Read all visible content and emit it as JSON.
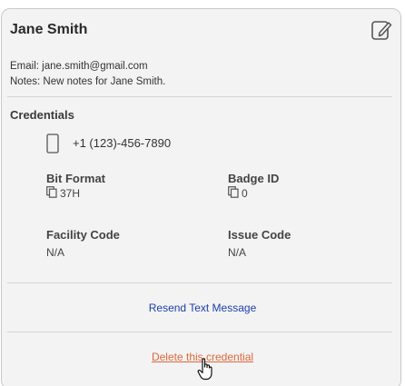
{
  "contact": {
    "name": "Jane Smith",
    "email": "Email: jane.smith@gmail.com",
    "notes": "Notes: New notes for Jane Smith."
  },
  "credentials": {
    "title": "Credentials",
    "phone": "+1 (123)-456-7890",
    "bit_format_label": "Bit Format",
    "bit_format_value": "37H",
    "badge_id_label": "Badge ID",
    "badge_id_value": "0",
    "facility_code_label": "Facility Code",
    "facility_code_value": "N/A",
    "issue_code_label": "Issue Code",
    "issue_code_value": "N/A"
  },
  "actions": {
    "resend_label": "Resend Text Message",
    "delete_label": "Delete this credential"
  },
  "icons": {
    "edit": "edit-icon",
    "phone": "phone-icon",
    "copy": "copy-icon",
    "cursor": "hand-cursor-icon"
  },
  "colors": {
    "card_background": "#f3f3f3",
    "link_blue": "#1a3fb0",
    "delete_orange": "#e0663b"
  }
}
